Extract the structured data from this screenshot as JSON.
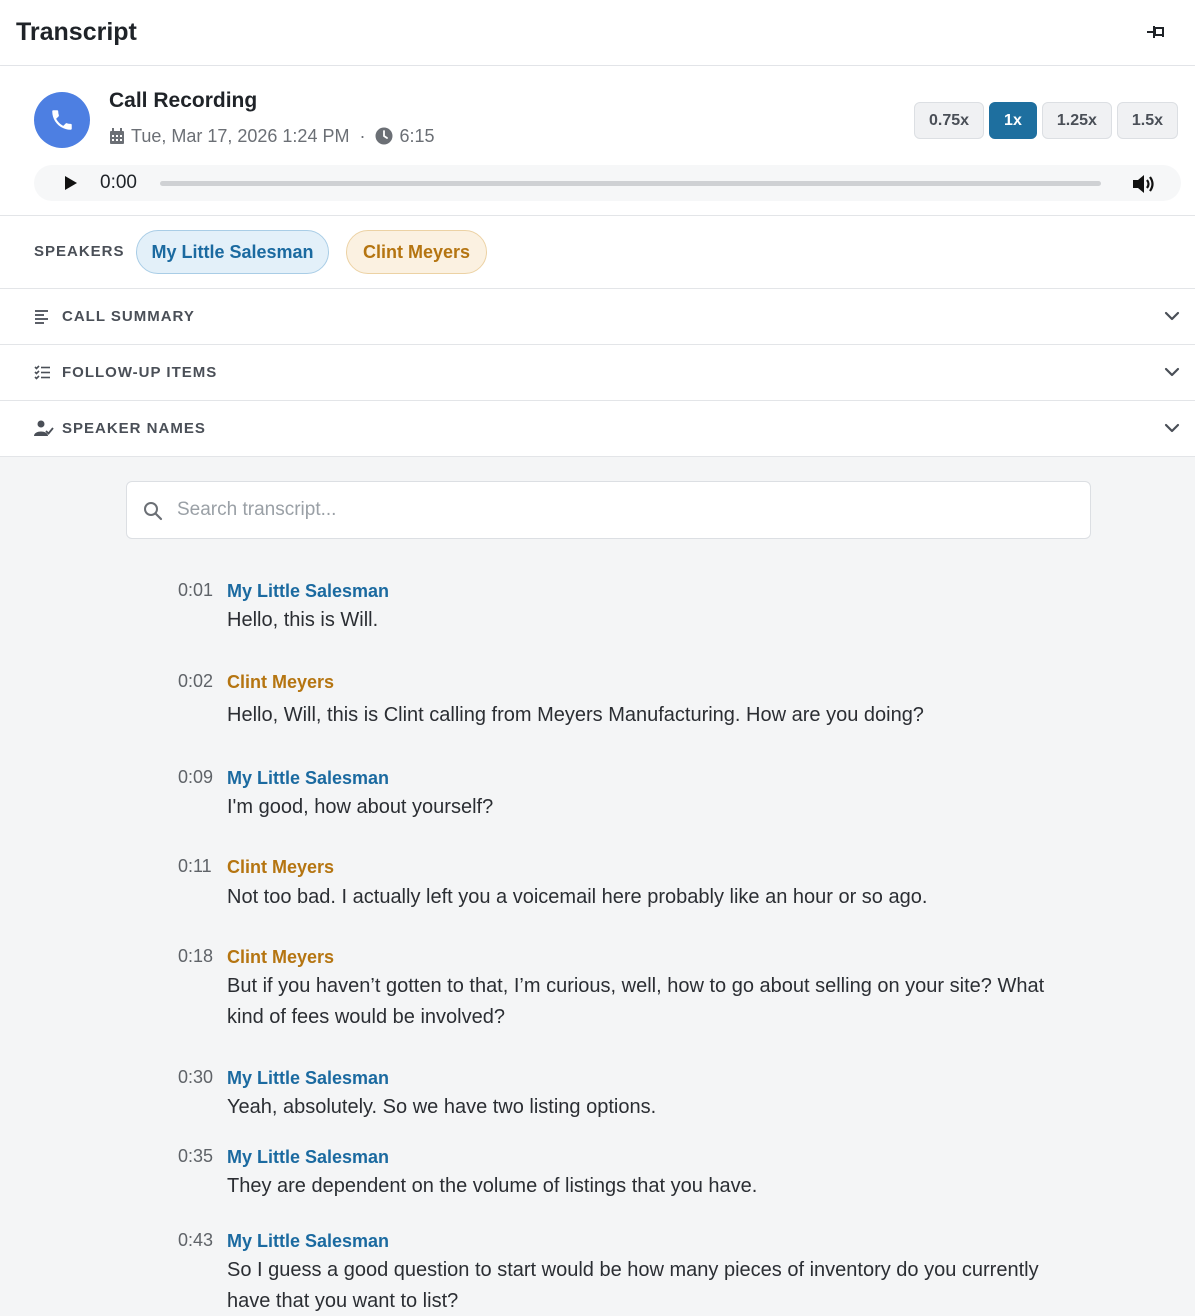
{
  "header": {
    "title": "Transcript",
    "pin_icon": "pin-icon"
  },
  "recording": {
    "title": "Call Recording",
    "date": "Tue, Mar 17, 2026 1:24 PM",
    "separator": "·",
    "duration": "6:15",
    "accent_color": "#4d7fe2",
    "speeds": [
      "0.75x",
      "1x",
      "1.25x",
      "1.5x"
    ],
    "active_speed": "1x",
    "current_time": "0:00",
    "progress": 0
  },
  "speakers": {
    "label": "SPEAKERS",
    "items": [
      {
        "name": "My Little Salesman",
        "color": "#1b6aa0"
      },
      {
        "name": "Clint Meyers",
        "color": "#b57511"
      }
    ]
  },
  "sections": [
    {
      "label": "CALL SUMMARY",
      "icon": "lines-icon"
    },
    {
      "label": "FOLLOW-UP ITEMS",
      "icon": "checklist-icon"
    },
    {
      "label": "SPEAKER NAMES",
      "icon": "user-check-icon"
    }
  ],
  "search": {
    "placeholder": "Search transcript..."
  },
  "transcript": [
    {
      "time": "0:01",
      "speaker": "My Little Salesman",
      "text": "Hello, this is Will."
    },
    {
      "time": "0:02",
      "speaker": "Clint Meyers",
      "text": "Hello, Will, this is Clint calling from Meyers Manufacturing. How are you doing?"
    },
    {
      "time": "0:09",
      "speaker": "My Little Salesman",
      "text": "I'm good, how about yourself?"
    },
    {
      "time": "0:11",
      "speaker": "Clint Meyers",
      "text": "Not too bad. I actually left you a voicemail here probably like an hour or so ago."
    },
    {
      "time": "0:18",
      "speaker": "Clint Meyers",
      "text": "But if you haven’t gotten to that, I’m curious, well, how to go about selling on your site? What kind of fees would be involved?"
    },
    {
      "time": "0:30",
      "speaker": "My Little Salesman",
      "text": "Yeah, absolutely. So we have two listing options."
    },
    {
      "time": "0:35",
      "speaker": "My Little Salesman",
      "text": "They are dependent on the volume of listings that you have."
    },
    {
      "time": "0:43",
      "speaker": "My Little Salesman",
      "text": "So I guess a good question to start would be how many pieces of inventory do you currently have that you want to list?"
    }
  ]
}
